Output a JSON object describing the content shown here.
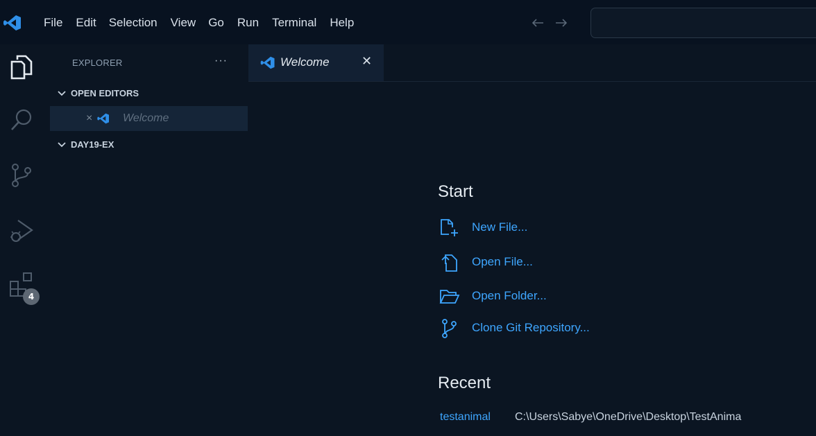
{
  "menu": {
    "items": [
      "File",
      "Edit",
      "Selection",
      "View",
      "Go",
      "Run",
      "Terminal",
      "Help"
    ]
  },
  "nav": {
    "back": "←",
    "forward": "→"
  },
  "activity_bar": {
    "items": [
      "explorer-icon",
      "search-icon",
      "source-control-icon",
      "run-debug-icon",
      "extensions-icon"
    ],
    "extensions_badge": "4"
  },
  "sidebar": {
    "title": "EXPLORER",
    "more": "···",
    "open_editors_label": "OPEN EDITORS",
    "open_editors": [
      {
        "close": "×",
        "label": "Welcome"
      }
    ],
    "folder_label": "DAY19-EX"
  },
  "tabs": [
    {
      "label": "Welcome",
      "close": "✕"
    }
  ],
  "welcome": {
    "start_title": "Start",
    "start_items": [
      {
        "label": "New File...",
        "icon": "new-file-icon"
      },
      {
        "label": "Open File...",
        "icon": "open-file-icon"
      },
      {
        "label": "Open Folder...",
        "icon": "open-folder-icon"
      },
      {
        "label": "Clone Git Repository...",
        "icon": "git-clone-icon"
      }
    ],
    "recent_title": "Recent",
    "recent": [
      {
        "name": "testanimal",
        "path": "C:\\Users\\Sabye\\OneDrive\\Desktop\\TestAnima"
      }
    ]
  },
  "colors": {
    "background": "#0b1522",
    "titlebar": "#081220",
    "accent_link": "#3ea6ff",
    "vscode_blue": "#2f8fe8"
  }
}
